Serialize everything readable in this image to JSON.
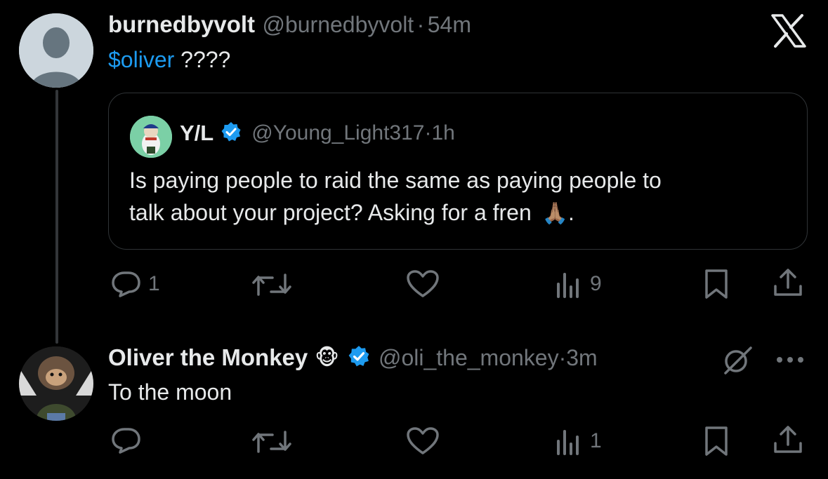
{
  "post": {
    "display_name": "burnedbyvolt",
    "handle": "@burnedbyvolt",
    "time": "54m",
    "mention": "$oliver",
    "text_rest": " ????",
    "actions": {
      "replies": "1",
      "views": "9"
    }
  },
  "quoted": {
    "display_name": "Y/L",
    "handle": "@Young_Light317",
    "time": "1h",
    "line1": "Is paying people to raid the same as paying people to",
    "line2": "talk about your project? Asking for a fren",
    "emoji": "🙏🏽",
    "trail": "."
  },
  "reply": {
    "display_name": "Oliver the Monkey",
    "name_emoji": "🐵",
    "handle": "@oli_the_monkey",
    "time": "3m",
    "text": "To the moon",
    "actions": {
      "views": "1"
    }
  },
  "separator": "·",
  "colors": {
    "link": "#1d9bf0",
    "verified": "#1d9bf0",
    "muted": "#71767b"
  }
}
